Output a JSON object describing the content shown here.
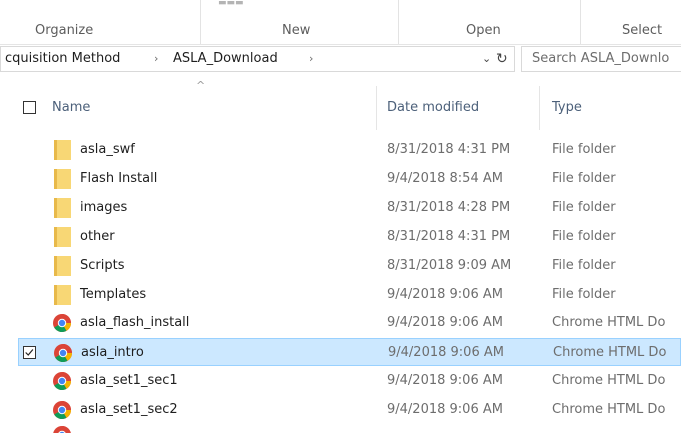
{
  "ribbon": {
    "groups": [
      {
        "label": "Organize"
      },
      {
        "label": "New"
      },
      {
        "label": "Open"
      },
      {
        "label": "Select"
      }
    ]
  },
  "address": {
    "breadcrumbs": [
      "cquisition Method",
      "ASLA_Download"
    ],
    "separator": "›",
    "dropdown_glyph": "⌄",
    "refresh_glyph": "↻"
  },
  "search": {
    "placeholder": "Search ASLA_Downlo"
  },
  "columns": {
    "name": "Name",
    "date_modified": "Date modified",
    "type": "Type"
  },
  "files": [
    {
      "name": "asla_swf",
      "date": "8/31/2018 4:31 PM",
      "type": "File folder",
      "icon": "folder-icon"
    },
    {
      "name": "Flash Install",
      "date": "9/4/2018 8:54 AM",
      "type": "File folder",
      "icon": "folder-icon"
    },
    {
      "name": "images",
      "date": "8/31/2018 4:28 PM",
      "type": "File folder",
      "icon": "folder-icon"
    },
    {
      "name": "other",
      "date": "8/31/2018 4:31 PM",
      "type": "File folder",
      "icon": "folder-icon"
    },
    {
      "name": "Scripts",
      "date": "8/31/2018 9:09 AM",
      "type": "File folder",
      "icon": "folder-icon"
    },
    {
      "name": "Templates",
      "date": "9/4/2018 9:06 AM",
      "type": "File folder",
      "icon": "folder-icon"
    },
    {
      "name": "asla_flash_install",
      "date": "9/4/2018 9:06 AM",
      "type": "Chrome HTML Do",
      "icon": "chrome-icon"
    },
    {
      "name": "asla_intro",
      "date": "9/4/2018 9:06 AM",
      "type": "Chrome HTML Do",
      "icon": "chrome-icon",
      "selected": true
    },
    {
      "name": "asla_set1_sec1",
      "date": "9/4/2018 9:06 AM",
      "type": "Chrome HTML Do",
      "icon": "chrome-icon"
    },
    {
      "name": "asla_set1_sec2",
      "date": "9/4/2018 9:06 AM",
      "type": "Chrome HTML Do",
      "icon": "chrome-icon"
    }
  ],
  "colors": {
    "selection_fill": "#cce8ff",
    "selection_border": "#99d1ff",
    "header_text": "#4c607a",
    "folder_yellow": "#f8d775"
  }
}
